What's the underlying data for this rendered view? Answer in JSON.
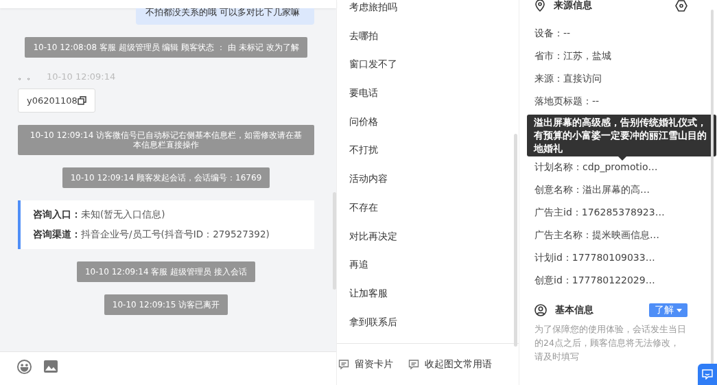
{
  "chat": {
    "messages": [
      {
        "kind": "bubble",
        "text": "不拍都没关系的哦 可以多对比下几家嘛"
      },
      {
        "kind": "system",
        "text": "10-10 12:08:08 客服 超级管理员 编辑 顾客状态 ： 由 未标记 改为了解"
      },
      {
        "kind": "visitor",
        "name": "。。",
        "time": "10-10 12:09:14",
        "card": "y06201108"
      },
      {
        "kind": "system",
        "text": "10-10 12:09:14 访客微信号已自动标记右侧基本信息栏，如需修改请在基本信息栏直接操作"
      },
      {
        "kind": "system",
        "text": "10-10 12:09:14 顾客发起会话，会话编号：16769"
      },
      {
        "kind": "entry",
        "lines": [
          {
            "label": "咨询入口：",
            "value": "未知(暂无入口信息)"
          },
          {
            "label": "咨询渠道：",
            "value": "抖音企业号/员工号(抖音号ID：279527392)"
          }
        ]
      },
      {
        "kind": "system",
        "text": "10-10 12:09:14 客服 超级管理员 接入会话"
      },
      {
        "kind": "system",
        "text": "10-10 12:09:15 访客已离开"
      }
    ]
  },
  "phrases": {
    "items": [
      "考虑旅拍吗",
      "去哪拍",
      "窗口发不了",
      "要电话",
      "问价格",
      "不打扰",
      "活动内容",
      "不存在",
      "对比再决定",
      "再追",
      "让加客服",
      "拿到联系后"
    ],
    "footer": [
      "留资卡片",
      "收起图文常用语"
    ]
  },
  "source_info": {
    "title": "来源信息",
    "rows_above": [
      "设备：--",
      "省市：江苏，盐城",
      "来源：直接访问",
      "落地页标题：--"
    ],
    "rows_below": [
      "计划名称：cdp_promotio…",
      "创意名称：溢出屏幕的高…",
      "广告主id：176285378923…",
      "广告主名称：提米映画信息…",
      "计划id：177780109033…",
      "创意id：177780122029…"
    ],
    "tooltip": "溢出屏幕的高级感，告别传统婚礼仪式，有预算的小富婆一定要冲的丽江雪山目的地婚礼"
  },
  "basic_info": {
    "title": "基本信息",
    "status": "了解",
    "hint": "为了保障您的使用体验，会话发生当日的24点之后，顾客信息将无法修改，请及时填写"
  }
}
